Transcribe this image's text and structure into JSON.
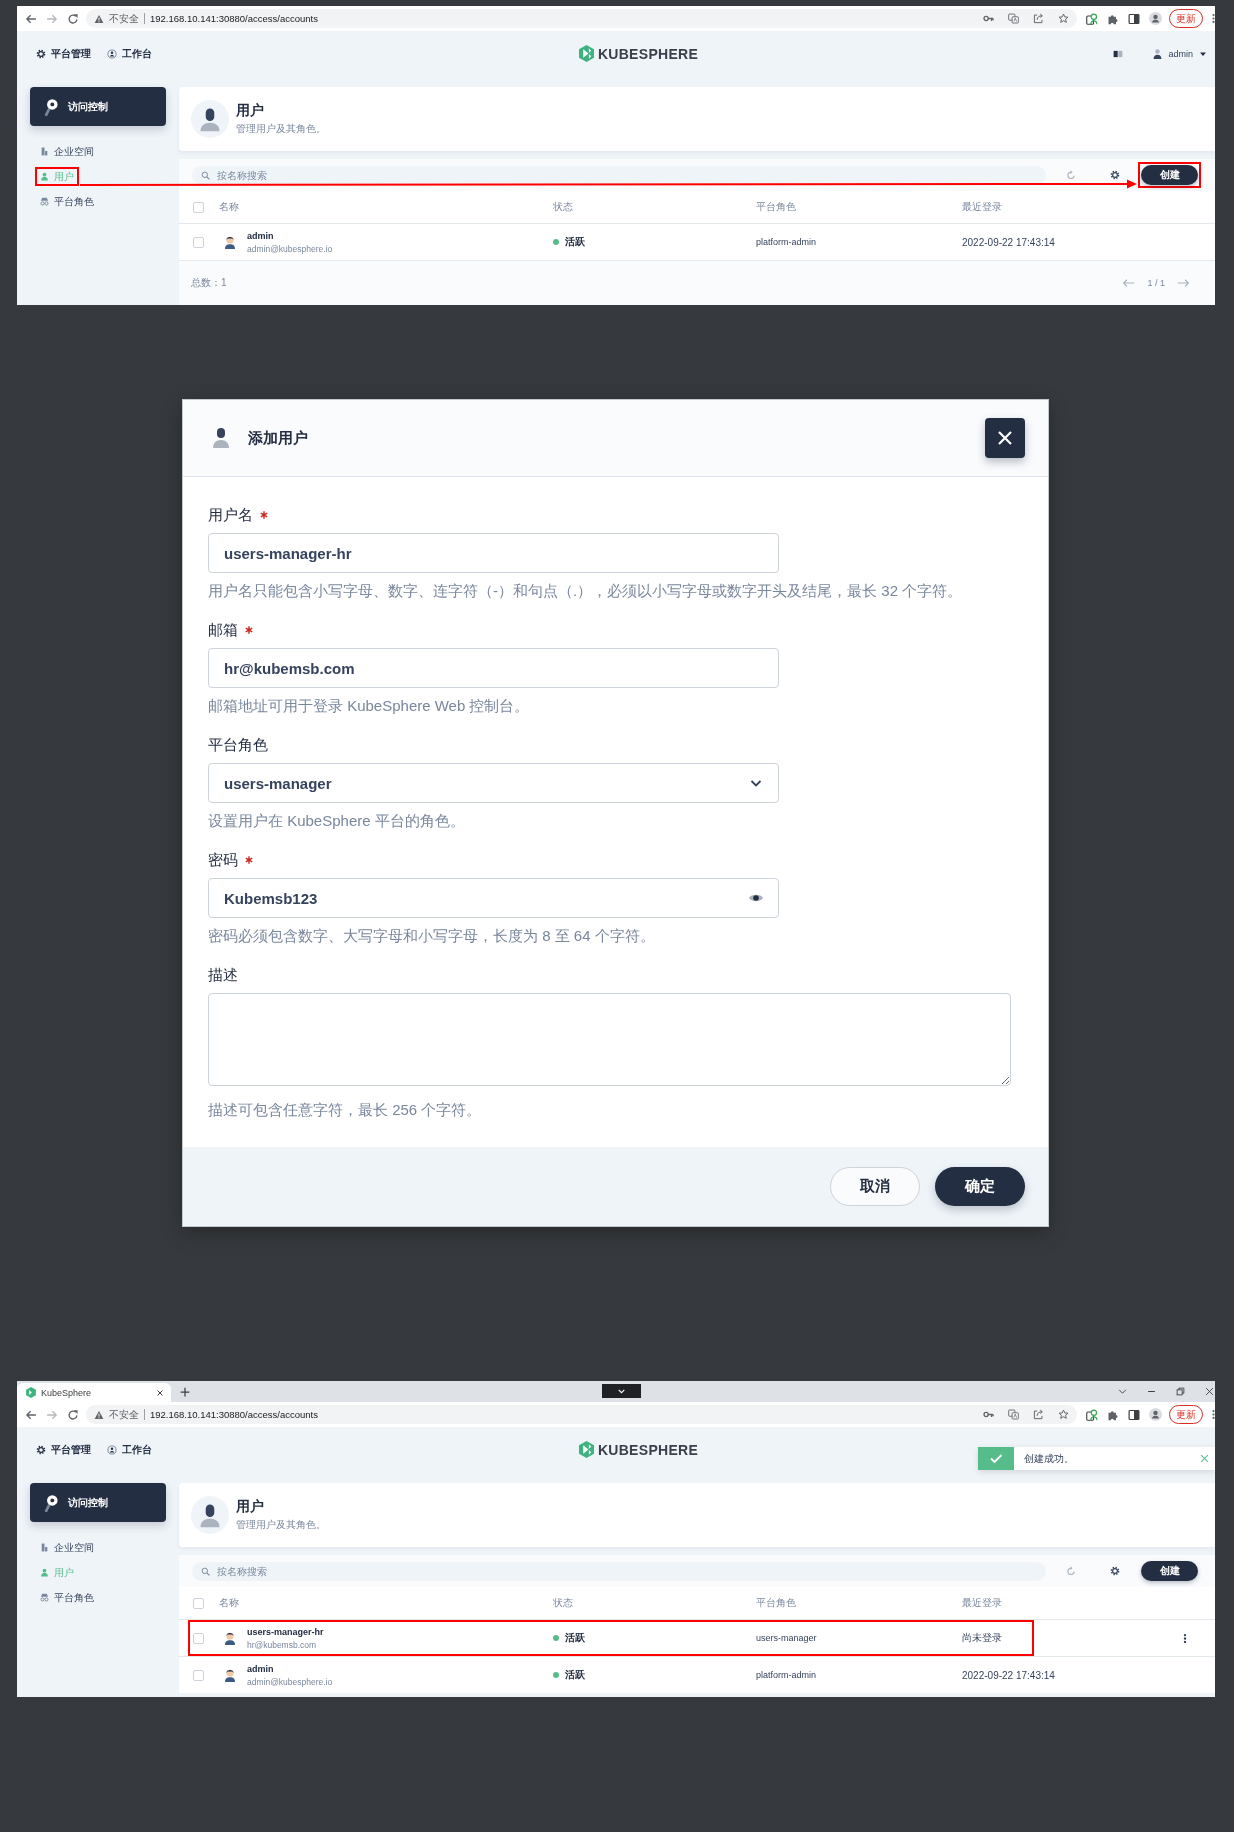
{
  "before_screenshot": {
    "address_bar": {
      "security_label": "不安全",
      "url": "192.168.10.141:30880/access/accounts",
      "update_button": "更新"
    },
    "top_nav": [
      {
        "label": "平台管理"
      },
      {
        "label": "工作台"
      }
    ],
    "logo": "KUBESPHERE",
    "user_menu": {
      "name": "admin"
    },
    "sidebar": {
      "title": "访问控制",
      "items": [
        {
          "label": "企业空间",
          "selected": false,
          "highlighted": false
        },
        {
          "label": "用户",
          "selected": true,
          "highlighted": true
        },
        {
          "label": "平台角色",
          "selected": false,
          "highlighted": false
        }
      ]
    },
    "page_header": {
      "title": "用户",
      "description": "管理用户及其角色。"
    },
    "toolbar": {
      "search_placeholder": "按名称搜索",
      "create_button": {
        "label": "创建",
        "highlighted": true
      }
    },
    "table": {
      "columns": [
        "名称",
        "状态",
        "平台角色",
        "最近登录"
      ],
      "select_all_checked": false,
      "rows": [
        {
          "name": "admin",
          "email": "admin@kubesphere.io",
          "status": "活跃",
          "role": "platform-admin",
          "last_login": "2022-09-22 17:43:14",
          "checked": false
        }
      ]
    },
    "footer": {
      "total": "总数：1",
      "page": "1 / 1"
    },
    "arrow_annotation": true
  },
  "add_user_dialog": {
    "title": "添加用户",
    "fields": [
      {
        "kind": "text",
        "label": "用户名",
        "required": true,
        "value": "users-manager-hr",
        "hint": "用户名只能包含小写字母、数字、连字符（-）和句点（.），必须以小写字母或数字开头及结尾，最长 32 个字符。"
      },
      {
        "kind": "text",
        "label": "邮箱",
        "required": true,
        "value": "hr@kubemsb.com",
        "hint": "邮箱地址可用于登录 KubeSphere Web 控制台。"
      },
      {
        "kind": "select",
        "label": "平台角色",
        "required": false,
        "value": "users-manager",
        "hint": "设置用户在 KubeSphere 平台的角色。"
      },
      {
        "kind": "password",
        "label": "密码",
        "required": true,
        "value": "Kubemsb123",
        "hint": "密码必须包含数字、大写字母和小写字母，长度为 8 至 64 个字符。"
      },
      {
        "kind": "textarea",
        "label": "描述",
        "required": false,
        "hint": "描述可包含任意字符，最长 256 个字符。"
      }
    ],
    "buttons": [
      {
        "label": "取消",
        "kind": "secondary"
      },
      {
        "label": "确定",
        "kind": "primary"
      }
    ]
  },
  "after_screenshot": {
    "browser_tab": {
      "title": "KubeSphere"
    },
    "address_bar": {
      "security_label": "不安全",
      "url": "192.168.10.141:30880/access/accounts",
      "update_button": "更新"
    },
    "top_nav": [
      {
        "label": "平台管理"
      },
      {
        "label": "工作台"
      }
    ],
    "logo": "KUBESPHERE",
    "toast": {
      "message": "创建成功。"
    },
    "sidebar": {
      "title": "访问控制",
      "items": [
        {
          "label": "企业空间",
          "selected": false
        },
        {
          "label": "用户",
          "selected": true
        },
        {
          "label": "平台角色",
          "selected": false
        }
      ]
    },
    "page_header": {
      "title": "用户",
      "description": "管理用户及其角色。"
    },
    "toolbar": {
      "search_placeholder": "按名称搜索",
      "create_button": {
        "label": "创建"
      }
    },
    "table": {
      "columns": [
        "名称",
        "状态",
        "平台角色",
        "最近登录"
      ],
      "select_all_checked": false,
      "rows": [
        {
          "name": "users-manager-hr",
          "email": "hr@kubemsb.com",
          "status": "活跃",
          "role": "users-manager",
          "last_login": "尚未登录",
          "checked": false,
          "highlighted": true,
          "menu_shown": true
        },
        {
          "name": "admin",
          "email": "admin@kubesphere.io",
          "status": "活跃",
          "role": "platform-admin",
          "last_login": "2022-09-22 17:43:14",
          "checked": false,
          "highlighted": false,
          "menu_shown": false
        }
      ]
    }
  }
}
